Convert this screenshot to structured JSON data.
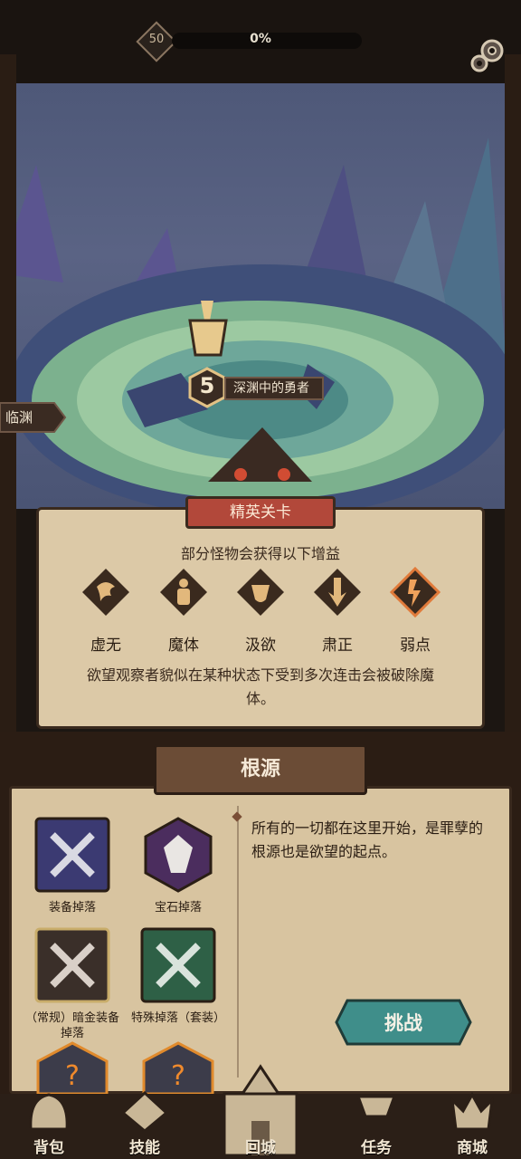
{
  "top": {
    "level": "50",
    "xp_percent_text": "0%",
    "xp_progress": 0
  },
  "stage": {
    "number": "5",
    "name": "深渊中的勇者"
  },
  "side_tag": "临渊",
  "elite": {
    "title": "精英关卡",
    "subtitle": "部分怪物会获得以下增益",
    "buffs": [
      {
        "label": "虚无",
        "icon": "void-icon"
      },
      {
        "label": "魔体",
        "icon": "demon-body-icon"
      },
      {
        "label": "汲欲",
        "icon": "absorb-desire-icon"
      },
      {
        "label": "肃正",
        "icon": "purge-icon"
      },
      {
        "label": "弱点",
        "icon": "weakness-icon"
      }
    ],
    "description": "欲望观察者貌似在某种状态下受到多次连击会被破除魔体。"
  },
  "origin": {
    "title": "根源",
    "description": "所有的一切都在这里开始，是罪孽的根源也是欲望的起点。",
    "rewards": [
      {
        "label": "装备掉落",
        "icon": "crossed-swords-icon"
      },
      {
        "label": "宝石掉落",
        "icon": "gem-icon"
      },
      {
        "label": "（常规）暗金装备掉落",
        "icon": "crossed-swords-gold-icon"
      },
      {
        "label": "特殊掉落（套装）",
        "icon": "crossed-swords-green-icon"
      }
    ],
    "challenge_label": "挑战"
  },
  "nav": [
    {
      "label": "背包",
      "icon": "bag-icon"
    },
    {
      "label": "技能",
      "icon": "skill-icon"
    },
    {
      "label": "回城",
      "icon": "castle-icon"
    },
    {
      "label": "任务",
      "icon": "quest-icon"
    },
    {
      "label": "商城",
      "icon": "shop-icon"
    }
  ],
  "colors": {
    "elite_red": "#b2483a",
    "challenge_teal": "#3f8e8a",
    "parchment": "#dcc9a7"
  }
}
